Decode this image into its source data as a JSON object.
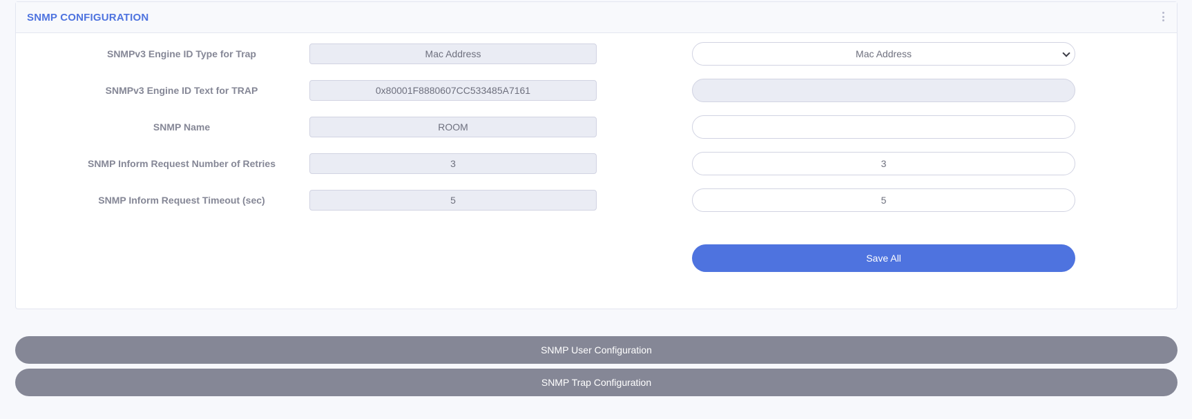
{
  "card": {
    "title": "SNMP CONFIGURATION"
  },
  "form": {
    "rows": [
      {
        "label": "SNMPv3 Engine ID Type for Trap",
        "current": "Mac Address",
        "input": "Mac Address"
      },
      {
        "label": "SNMPv3 Engine ID Text for TRAP",
        "current": "0x80001F8880607CC533485A7161",
        "input": ""
      },
      {
        "label": "SNMP Name",
        "current": "ROOM",
        "input": ""
      },
      {
        "label": "SNMP Inform Request Number of Retries",
        "current": "3",
        "input": "3"
      },
      {
        "label": "SNMP Inform Request Timeout (sec)",
        "current": "5",
        "input": "5"
      }
    ],
    "save_label": "Save All"
  },
  "buttons": {
    "user_config": "SNMP User Configuration",
    "trap_config": "SNMP Trap Configuration"
  },
  "colors": {
    "accent": "#4e73df",
    "secondary_button": "#858796",
    "page_background": "#f7f8fc"
  },
  "icons": {
    "menu": "kebab-menu-icon",
    "select": "chevron-down-icon"
  }
}
